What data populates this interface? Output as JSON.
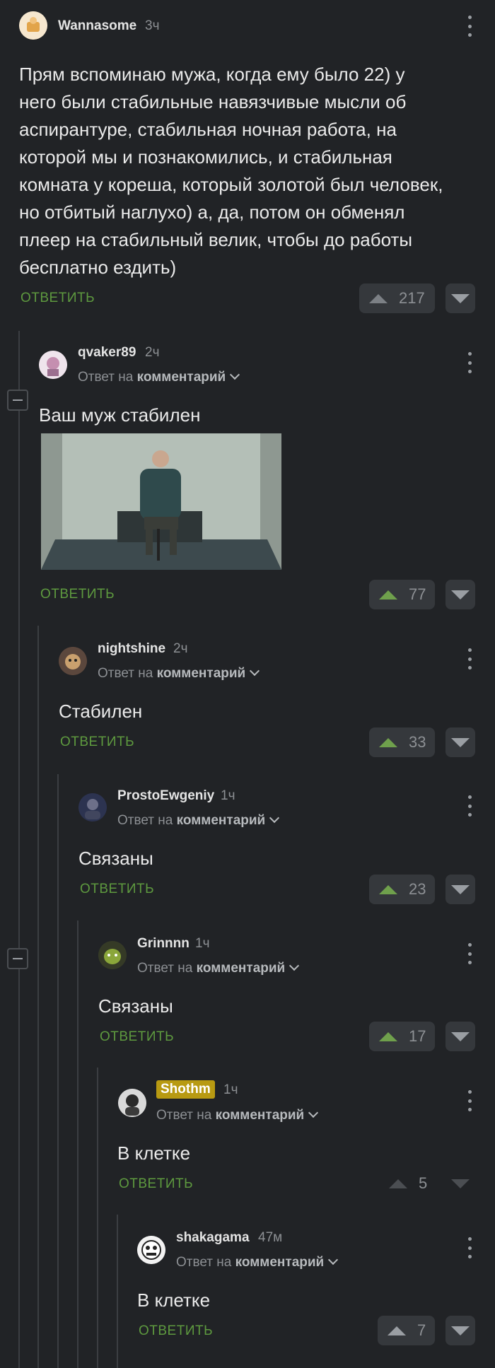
{
  "colors": {
    "background": "#212326",
    "accent_green": "#5e9a3f",
    "badge": "#b89a12"
  },
  "reply_to_prefix": "Ответ на",
  "reply_to_target": "комментарий",
  "reply_label": "ОТВЕТИТЬ",
  "comments": [
    {
      "user": "Wannasome",
      "time": "3ч",
      "text_lines": [
        "Прям вспоминаю мужа, когда ему было 22) у",
        "него были стабильные навязчивые мысли об",
        "аспирантуре, стабильная ночная работа, на",
        "которой мы и познакомились, и стабильная",
        "комната у кореша, который золотой был человек,",
        "но отбитый наглухо) а, да, потом он обменял",
        "плеер на стабильный велик, чтобы до работы",
        "бесплатно ездить)"
      ],
      "votes": "217"
    },
    {
      "user": "qvaker89",
      "time": "2ч",
      "text": "Ваш муж стабилен",
      "votes": "77"
    },
    {
      "user": "nightshine",
      "time": "2ч",
      "text": "Стабилен",
      "votes": "33"
    },
    {
      "user": "ProstoEwgeniy",
      "time": "1ч",
      "text": "Связаны",
      "votes": "23"
    },
    {
      "user": "Grinnnn",
      "time": "1ч",
      "text": "Связаны",
      "votes": "17"
    },
    {
      "user": "Shothm",
      "time": "1ч",
      "text": "В клетке",
      "votes": "5"
    },
    {
      "user": "shakagama",
      "time": "47м",
      "text": "В клетке",
      "votes": "7"
    }
  ]
}
